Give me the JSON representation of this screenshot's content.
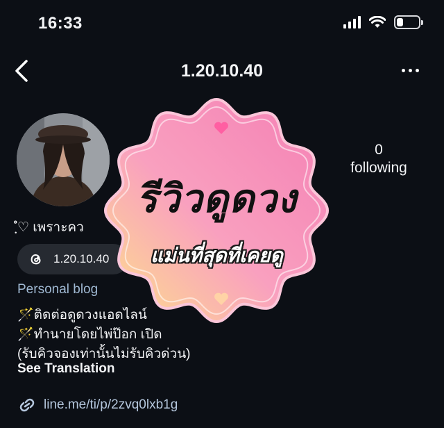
{
  "status_bar": {
    "time": "16:33"
  },
  "nav": {
    "title": "1.20.10.40"
  },
  "profile": {
    "following_count": "0",
    "following_label": "following",
    "display_name": "ฺํ♡ เพราะคว",
    "threads_handle": "1.20.10.40",
    "category": "Personal blog",
    "bio": [
      "🪄ติดต่อดูดวงแอดไลน์",
      "🪄ทำนายโดยไพ่ป๊อก เปิด",
      "(รับคิวจองเท่านั้นไม่รับคิวด่วน)"
    ],
    "see_translation": "See Translation",
    "link": "line.me/ti/p/2zvq0lxb1g"
  },
  "overlay": {
    "title": "รีวิวดูดวง",
    "subtitle": "แม่นที่สุดที่เคยดู"
  },
  "colors": {
    "background": "#0c0f15",
    "chip": "#262a31",
    "link": "#b4c6dc",
    "category": "#9fb8d2",
    "badge_pink": "#f47fb4",
    "badge_yellow": "#fde28a"
  },
  "icons": [
    "signal-icon",
    "wifi-icon",
    "battery-icon",
    "back-icon",
    "more-icon",
    "threads-icon",
    "link-icon",
    "heart-icon"
  ]
}
